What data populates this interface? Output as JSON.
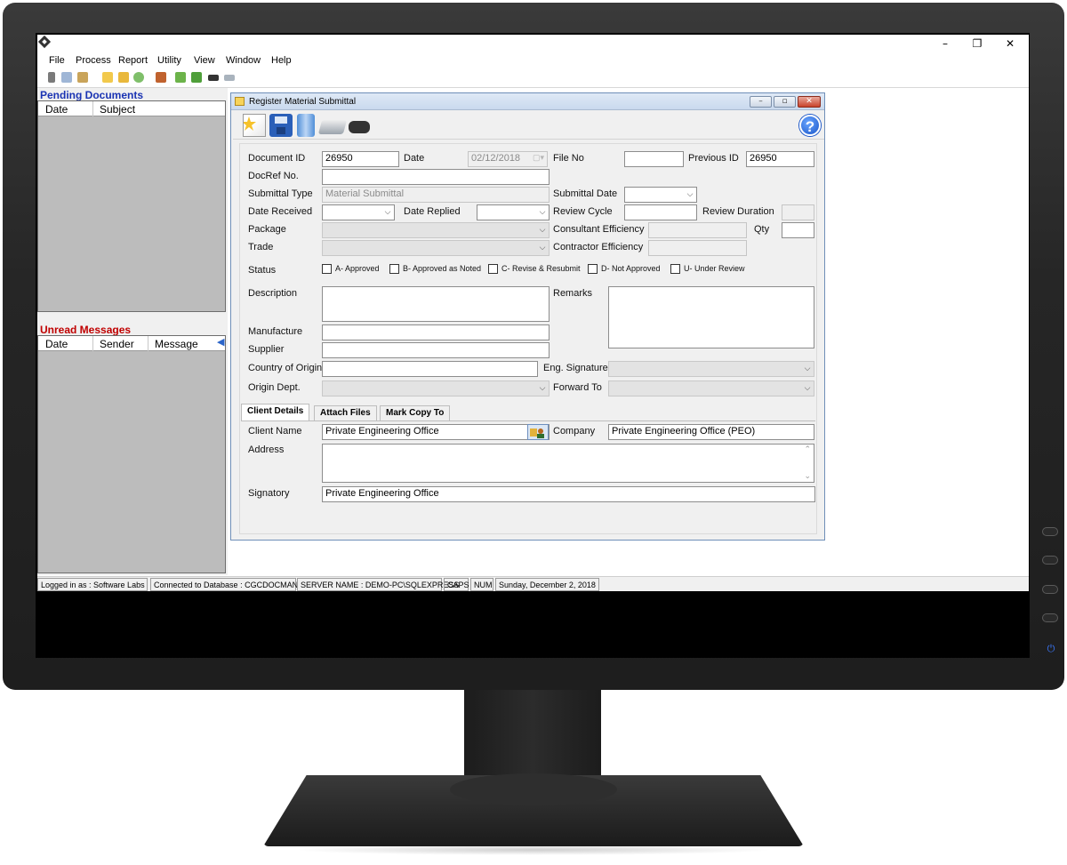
{
  "window": {
    "controls": {
      "minimize": "–",
      "restore": "❐",
      "close": "✕"
    }
  },
  "menu": [
    "File",
    "Process",
    "Report",
    "Utility",
    "View",
    "Window",
    "Help"
  ],
  "toolbar_icons": [
    "cut-icon",
    "copy-icon",
    "paste-icon",
    "new-folder-icon",
    "open-folder-icon",
    "refresh-icon",
    "print-icon",
    "forward-icon",
    "reply-icon",
    "binoculars-icon",
    "scanner-icon"
  ],
  "pending": {
    "title": "Pending Documents",
    "columns": [
      "Date",
      "Subject"
    ]
  },
  "unread": {
    "title": "Unread Messages",
    "columns": [
      "Date",
      "Sender",
      "Message"
    ]
  },
  "dialog": {
    "title": "Register Material Submittal",
    "controls": {
      "minimize": "–",
      "restore": "▫",
      "close": "✕"
    },
    "help": "?"
  },
  "form": {
    "document_id": {
      "label": "Document ID",
      "value": "26950"
    },
    "date": {
      "label": "Date",
      "value": "02/12/2018"
    },
    "file_no": {
      "label": "File No",
      "value": ""
    },
    "previous_id": {
      "label": "Previous ID",
      "value": "26950"
    },
    "docref": {
      "label": "DocRef No.",
      "value": ""
    },
    "submittal_type": {
      "label": "Submittal Type",
      "value": "Material Submittal"
    },
    "submittal_date": {
      "label": "Submittal Date",
      "value": ""
    },
    "date_received": {
      "label": "Date Received",
      "value": ""
    },
    "date_replied": {
      "label": "Date Replied",
      "value": ""
    },
    "review_cycle": {
      "label": "Review Cycle",
      "value": ""
    },
    "review_duration": {
      "label": "Review Duration",
      "value": ""
    },
    "package": {
      "label": "Package",
      "value": ""
    },
    "consultant_efficiency": {
      "label": "Consultant Efficiency",
      "value": ""
    },
    "qty": {
      "label": "Qty",
      "value": ""
    },
    "trade": {
      "label": "Trade",
      "value": ""
    },
    "contractor_efficiency": {
      "label": "Contractor Efficiency",
      "value": ""
    },
    "status": {
      "label": "Status",
      "options": [
        "A- Approved",
        "B- Approved as Noted",
        "C- Revise & Resubmit",
        "D- Not Approved",
        "U- Under Review"
      ]
    },
    "description": {
      "label": "Description",
      "value": ""
    },
    "remarks": {
      "label": "Remarks",
      "value": ""
    },
    "manufacture": {
      "label": "Manufacture",
      "value": ""
    },
    "supplier": {
      "label": "Supplier",
      "value": ""
    },
    "country_of_origin": {
      "label": "Country of Origin",
      "value": ""
    },
    "eng_signature": {
      "label": "Eng. Signature",
      "value": ""
    },
    "origin_dept": {
      "label": "Origin Dept.",
      "value": ""
    },
    "forward_to": {
      "label": "Forward To",
      "value": ""
    }
  },
  "tabs": [
    "Client Details",
    "Attach Files",
    "Mark Copy To"
  ],
  "client": {
    "client_name": {
      "label": "Client Name",
      "value": "Private Engineering Office"
    },
    "company": {
      "label": "Company",
      "value": "Private Engineering Office (PEO)"
    },
    "address": {
      "label": "Address",
      "value": ""
    },
    "signatory": {
      "label": "Signatory",
      "value": "Private Engineering Office"
    }
  },
  "statusbar": [
    "Logged in as : Software Labs",
    "Connected to Database : CGCDOCMAN",
    "SERVER NAME : DEMO-PC\\SQLEXPRESS",
    "CAPS",
    "NUM",
    "Sunday, December 2, 2018"
  ],
  "colors": {
    "pending_title": "#1a33b3",
    "unread_title": "#c00000",
    "panel_bg": "#bcbcbc",
    "dialog_title_bg": "#cfdcef"
  },
  "monitor": {
    "power_icon": "⏻"
  }
}
